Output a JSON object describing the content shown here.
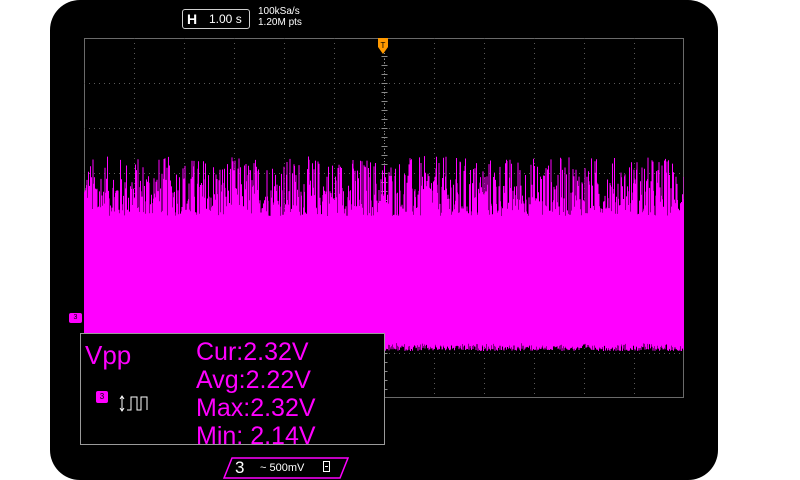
{
  "timebase": {
    "label": "H",
    "value": "1.00 s"
  },
  "acquisition": {
    "sample_rate": "100kSa/s",
    "points": "1.20M pts"
  },
  "trigger": {
    "marker": "T",
    "color": "#ff9900"
  },
  "channel": {
    "number": "3",
    "scale": "500mV",
    "coupling_symbol": "~",
    "color": "#ff00ff"
  },
  "measurement": {
    "name": "Vpp",
    "source": "3",
    "rows": [
      {
        "label": "Cur:",
        "value": "2.32V"
      },
      {
        "label": "Avg:",
        "value": "2.22V"
      },
      {
        "label": "Max:",
        "value": "2.32V"
      },
      {
        "label": "Min:",
        "value": "2.14V"
      }
    ]
  }
}
